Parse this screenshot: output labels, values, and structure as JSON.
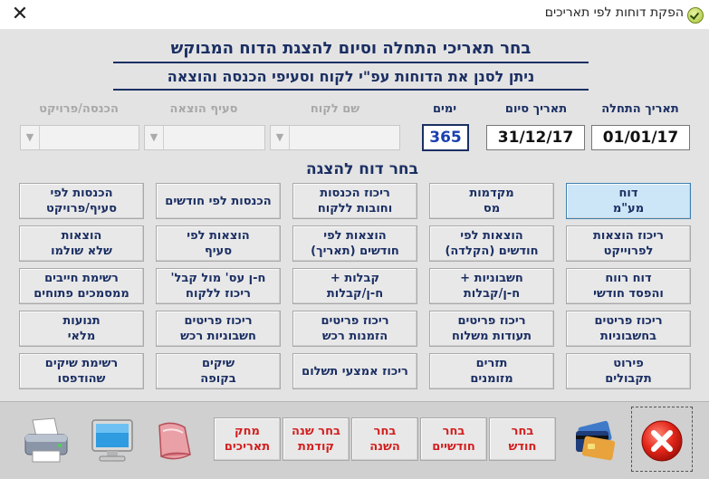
{
  "window": {
    "title": "הפקת דוחות לפי תאריכים"
  },
  "header": {
    "line1": "בחר תאריכי התחלה וסיום להצגת הדוח המבוקש",
    "line2": "ניתן לסנן את הדוחות עפ\"י לקוח וסעיפי הכנסה והוצאה"
  },
  "fields": {
    "start_label": "תאריך התחלה",
    "start_value": "01/01/17",
    "end_label": "תאריך סיום",
    "end_value": "31/12/17",
    "days_label": "ימים",
    "days_value": "365",
    "customer_label": "שם לקוח",
    "expense_label": "סעיף הוצאה",
    "income_label": "הכנסה/פרויקט"
  },
  "section_title": "בחר דוח להצגה",
  "reports": {
    "r1c1": "דוח\nמע\"מ",
    "r1c2": "מקדמות\nמס",
    "r1c3": "ריכוז הכנסות\nוחובות ללקוח",
    "r1c4": "הכנסות לפי חודשים",
    "r1c5": "הכנסות לפי\nסעיף/פרויקט",
    "r2c1": "ריכוז הוצאות\nלפרוייקט",
    "r2c2": "הוצאות לפי\nחודשים (הקלדה)",
    "r2c3": "הוצאות לפי\nחודשים (תאריך)",
    "r2c4": "הוצאות לפי\nסעיף",
    "r2c5": "הוצאות\nשלא שולמו",
    "r3c1": "דוח רווח\nוהפסד חודשי",
    "r3c2": "חשבוניות +\nח-ן/קבלות",
    "r3c3": "קבלות +\nח-ן/קבלות",
    "r3c4": "ח-ן עס' מול קבל'\nריכוז ללקוח",
    "r3c5": "רשימת חייבים\nממסמכים פתוחים",
    "r4c1": "ריכוז פריטים\nבחשבוניות",
    "r4c2": "ריכוז פריטים\nתעודות משלוח",
    "r4c3": "ריכוז פריטים\nהזמנות רכש",
    "r4c4": "ריכוז פריטים\nחשבוניות רכש",
    "r4c5": "תנועות\nמלאי",
    "r5c1": "פירוט\nתקבולים",
    "r5c2": "תזרים\nמזומנים",
    "r5c3": "ריכוז אמצעי תשלום",
    "r5c4": "שיקים\nבקופה",
    "r5c5": "רשימת שיקים\nשהודפסו"
  },
  "bottom": {
    "month": "בחר\nחודש",
    "two_months": "בחר\nחודשיים",
    "year": "בחר\nהשנה",
    "prev_year": "בחר שנה\nקודמת",
    "clear": "מחק\nתאריכים"
  },
  "colors": {
    "label_blue": "#1b2f63",
    "days_blue": "#1b3fb0",
    "action_red": "#d21e1e",
    "selected_bg": "#cde6f7"
  }
}
